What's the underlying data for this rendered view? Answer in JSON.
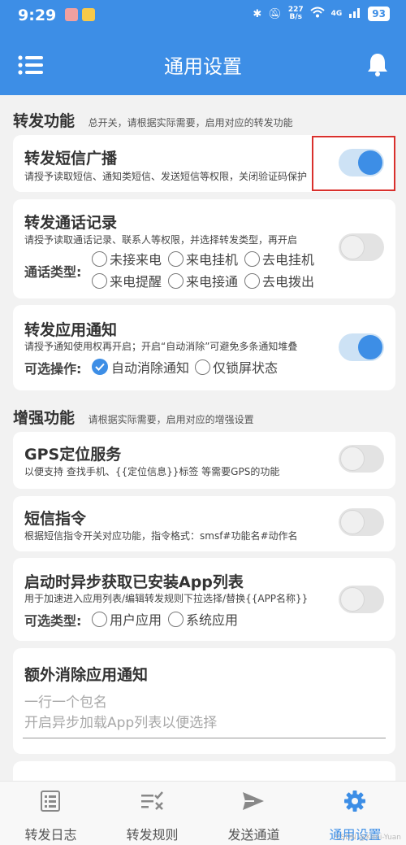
{
  "status": {
    "time": "9:29",
    "speed_value": "227",
    "speed_unit": "B/s",
    "network": "4G",
    "battery": "93"
  },
  "appbar": {
    "title": "通用设置"
  },
  "sections": {
    "forward": {
      "title": "转发功能",
      "subtitle": "总开关，请根据实际需要，启用对应的转发功能"
    },
    "enhance": {
      "title": "增强功能",
      "subtitle": "请根据实际需要，启用对应的增强设置"
    }
  },
  "cards": {
    "sms": {
      "title": "转发短信广播",
      "desc": "请授予读取短信、通知类短信、发送短信等权限，关闭验证码保护",
      "enabled": true
    },
    "call": {
      "title": "转发通话记录",
      "desc": "请授予读取通话记录、联系人等权限，并选择转发类型，再开启",
      "options_label": "通话类型:",
      "options": [
        "未接来电",
        "来电挂机",
        "去电挂机",
        "来电提醒",
        "来电接通",
        "去电拨出"
      ],
      "enabled": false
    },
    "app_notify": {
      "title": "转发应用通知",
      "desc": "请授予通知使用权再开启；开启“自动消除”可避免多条通知堆叠",
      "options_label": "可选操作:",
      "options": [
        "自动消除通知",
        "仅锁屏状态"
      ],
      "enabled": true
    },
    "gps": {
      "title": "GPS定位服务",
      "desc": "以便支持 查找手机、{{定位信息}}标签 等需要GPS的功能",
      "enabled": false
    },
    "sms_cmd": {
      "title": "短信指令",
      "desc": "根据短信指令开关对应功能，指令格式：smsf#功能名#动作名",
      "enabled": false
    },
    "app_list": {
      "title": "启动时异步获取已安装App列表",
      "desc": "用于加速进入应用列表/编辑转发规则下拉选择/替换{{APP名称}}",
      "options_label": "可选类型:",
      "options": [
        "用户应用",
        "系统应用"
      ],
      "enabled": false
    },
    "extra_clear": {
      "title": "额外消除应用通知",
      "placeholder_line1": "一行一个包名",
      "placeholder_line2": "开启异步加载App列表以便选择"
    }
  },
  "nav": {
    "items": [
      {
        "label": "转发日志",
        "icon": "list-icon"
      },
      {
        "label": "转发规则",
        "icon": "rules-icon"
      },
      {
        "label": "发送通道",
        "icon": "send-icon"
      },
      {
        "label": "通用设置",
        "icon": "gear-icon"
      }
    ],
    "active_index": 3
  },
  "watermark": "CSDN @Kimi-Yuan",
  "colors": {
    "primary": "#3d8ee6",
    "highlight": "#d9302c",
    "background": "#f2f2f2"
  }
}
